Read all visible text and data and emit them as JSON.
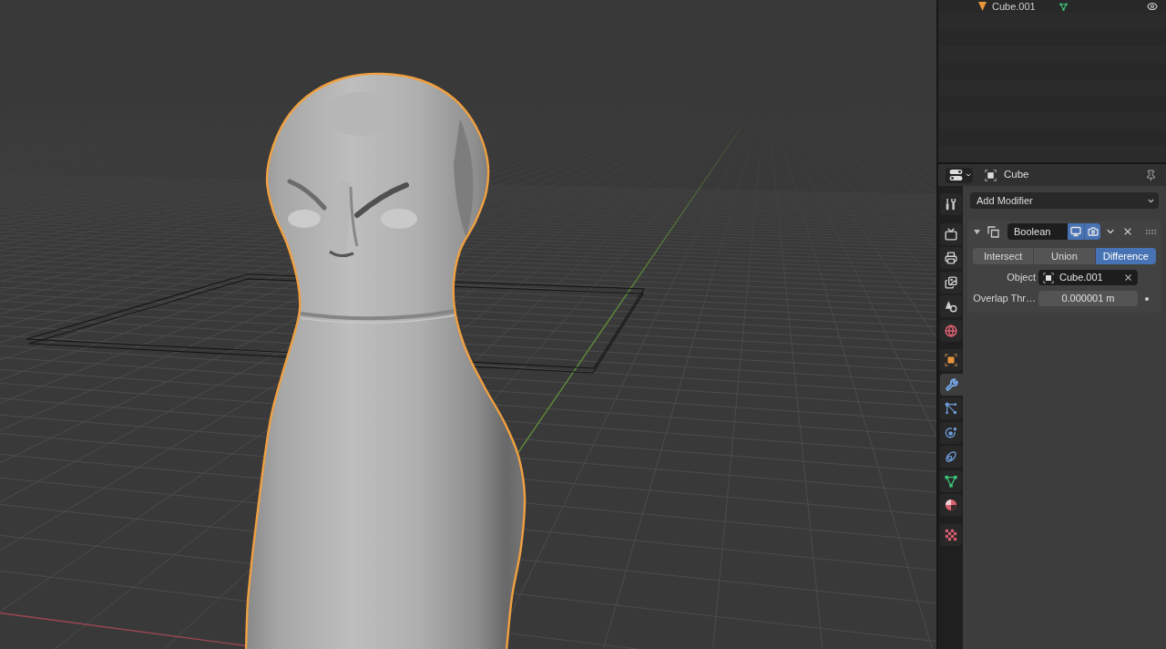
{
  "outliner": {
    "rows": [
      {
        "name": "Cube.001"
      }
    ]
  },
  "properties": {
    "header": {
      "object_name": "Cube"
    },
    "tab_groups": [
      [
        {
          "kind": "tool",
          "selected": false
        }
      ],
      [
        {
          "kind": "render",
          "selected": false
        },
        {
          "kind": "output",
          "selected": false
        },
        {
          "kind": "view_layer",
          "selected": false
        },
        {
          "kind": "scene",
          "selected": false
        },
        {
          "kind": "world",
          "selected": false
        }
      ],
      [
        {
          "kind": "object",
          "selected": false
        },
        {
          "kind": "modifier",
          "selected": true
        },
        {
          "kind": "particles",
          "selected": false
        },
        {
          "kind": "physics",
          "selected": false
        },
        {
          "kind": "constraints",
          "selected": false
        },
        {
          "kind": "data",
          "selected": false
        },
        {
          "kind": "material",
          "selected": false
        }
      ],
      [
        {
          "kind": "texture",
          "selected": false
        }
      ]
    ],
    "add_modifier": {
      "label": "Add Modifier"
    },
    "modifiers": [
      {
        "expanded": true,
        "name": "Boolean",
        "show_viewport": true,
        "show_render": true,
        "operations": [
          {
            "label": "Intersect",
            "selected": false
          },
          {
            "label": "Union",
            "selected": false
          },
          {
            "label": "Difference",
            "selected": true
          }
        ],
        "fields": [
          {
            "kind": "object",
            "label": "Object",
            "value": "Cube.001"
          },
          {
            "kind": "number",
            "label": "Overlap Thr…",
            "value": "0.000001 m"
          }
        ]
      }
    ]
  }
}
